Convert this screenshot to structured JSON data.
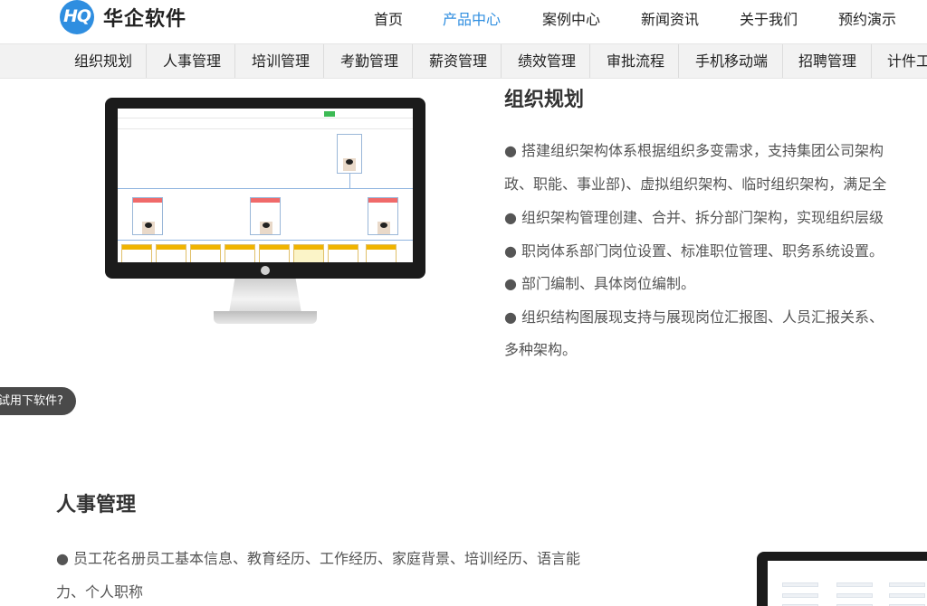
{
  "brand": {
    "logo_text": "HQ",
    "name": "华企软件",
    "accent": "#2f8ee0"
  },
  "topnav": [
    {
      "label": "首页",
      "active": false
    },
    {
      "label": "产品中心",
      "active": true
    },
    {
      "label": "案例中心",
      "active": false
    },
    {
      "label": "新闻资讯",
      "active": false
    },
    {
      "label": "关于我们",
      "active": false
    },
    {
      "label": "预约演示",
      "active": false
    }
  ],
  "subnav": [
    "组织规划",
    "人事管理",
    "培训管理",
    "考勤管理",
    "薪资管理",
    "绩效管理",
    "审批流程",
    "手机移动端",
    "招聘管理",
    "计件工"
  ],
  "section1": {
    "title": "组织规划",
    "lines": [
      "● 搭建组织架构体系根据组织多变需求，支持集团公司架构",
      "政、职能、事业部)、虚拟组织架构、临时组织架构，满足全",
      "● 组织架构管理创建、合并、拆分部门架构，实现组织层级",
      "● 职岗体系部门岗位设置、标准职位管理、职务系统设置。",
      "● 部门编制、具体岗位编制。",
      "● 组织结构图展现支持与展现岗位汇报图、人员汇报关系、",
      "多种架构。"
    ]
  },
  "float_tab": {
    "label": "试用下软件?"
  },
  "section2": {
    "title": "人事管理",
    "lines": [
      "● 员工花名册员工基本信息、教育经历、工作经历、家庭背景、培训经历、语言能",
      "力、个人职称"
    ]
  }
}
